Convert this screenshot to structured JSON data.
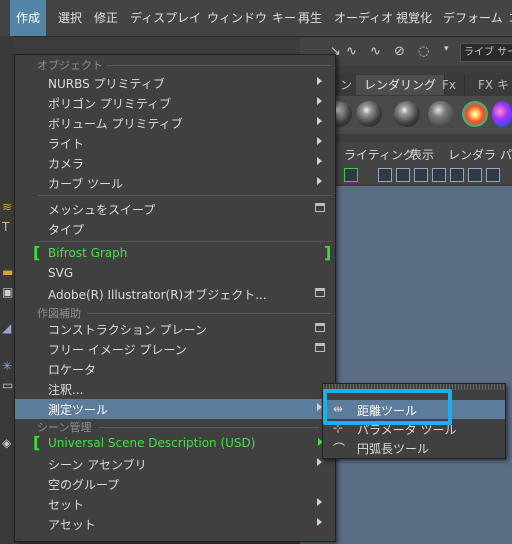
{
  "menubar": {
    "items": [
      "作成",
      "選択",
      "修正",
      "ディスプレイ",
      "ウィンドウ",
      "キー",
      "再生",
      "オーディオ",
      "視覚化",
      "デフォーム",
      "コ"
    ]
  },
  "shelf": {
    "live_field": "ライブ サーフ"
  },
  "tabs": [
    "ン",
    "レンダリング",
    "Fx",
    "FX キ"
  ],
  "panel_menu": [
    "ライティング",
    "表示",
    "レンダラ",
    "パ"
  ],
  "menu": {
    "sections": {
      "objects": "オブジェクト",
      "construction": "作図補助",
      "scene": "シーン管理"
    },
    "items": [
      {
        "label": "NURBS プリミティブ"
      },
      {
        "label": "ポリゴン プリミティブ"
      },
      {
        "label": "ボリューム プリミティブ"
      },
      {
        "label": "ライト"
      },
      {
        "label": "カメラ"
      },
      {
        "label": "カーブ ツール"
      },
      {
        "label": "メッシュをスイープ"
      },
      {
        "label": "タイプ"
      },
      {
        "label": "Bifrost Graph"
      },
      {
        "label": "SVG"
      },
      {
        "label": "Adobe(R) Illustrator(R)オブジェクト..."
      },
      {
        "label": "コンストラクション プレーン"
      },
      {
        "label": "フリー イメージ プレーン"
      },
      {
        "label": "ロケータ"
      },
      {
        "label": "注釈..."
      },
      {
        "label": "測定ツール"
      },
      {
        "label": "Universal Scene Description (USD)"
      },
      {
        "label": "シーン アセンブリ"
      },
      {
        "label": "空のグループ"
      },
      {
        "label": "セット"
      },
      {
        "label": "アセット"
      }
    ]
  },
  "submenu": {
    "items": [
      {
        "label": "距離ツール"
      },
      {
        "label": "パラメータ ツール"
      },
      {
        "label": "円弧長ツール"
      }
    ]
  },
  "colors": {
    "menu_bg": "#404040",
    "highlight": "#5c7c9c",
    "menubar_active": "#5285a6",
    "bifrost_green": "#44e044",
    "callout_blue": "#1ab0f0",
    "viewport": "#5b6d85"
  }
}
